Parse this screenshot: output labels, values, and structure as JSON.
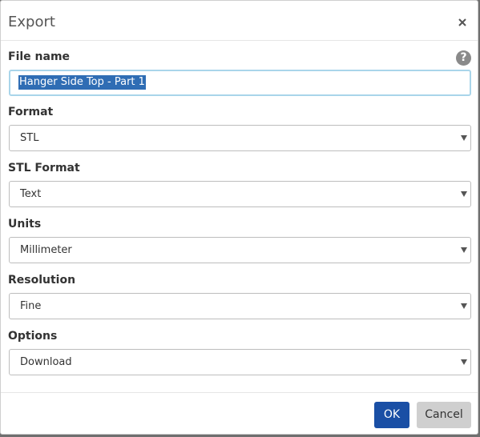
{
  "dialog": {
    "title": "Export",
    "close_icon": "close-icon",
    "help_icon": "question-circle-icon",
    "help_glyph": "?"
  },
  "fields": {
    "file_name": {
      "label": "File name",
      "value": "Hanger Side Top - Part 1",
      "selected": true
    },
    "format": {
      "label": "Format",
      "value": "STL"
    },
    "stl_format": {
      "label": "STL Format",
      "value": "Text"
    },
    "units": {
      "label": "Units",
      "value": "Millimeter"
    },
    "resolution": {
      "label": "Resolution",
      "value": "Fine"
    },
    "options": {
      "label": "Options",
      "value": "Download"
    }
  },
  "footer": {
    "ok_label": "OK",
    "cancel_label": "Cancel"
  },
  "colors": {
    "primary_button": "#1a4fa5",
    "secondary_button": "#cfcfcf",
    "selection": "#2f6db4",
    "focus_border": "#a9d5ea"
  }
}
